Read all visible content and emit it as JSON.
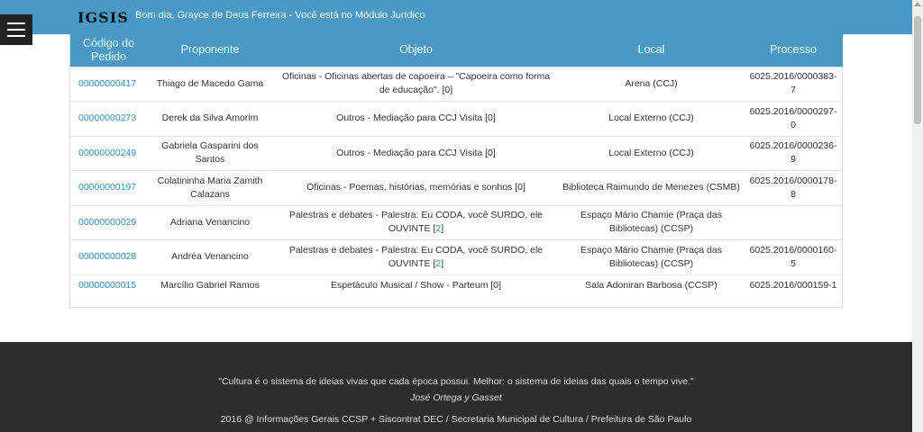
{
  "header": {
    "logo": "IGSIS",
    "greeting": "Bom dia, Grayce de Deus Ferreira - Você está no Módulo Jurídico"
  },
  "table": {
    "columns": [
      "Código do Pedido",
      "Proponente",
      "Objeto",
      "Local",
      "Processo"
    ],
    "rows": [
      {
        "code": "00000000417",
        "proponent": "Thiago de Macedo Gama",
        "object": "Oficinas - Oficinas abertas de capoeira – \"Capoeira como forma de educação\". [0]",
        "local": "Arena (CCJ)",
        "process": "6025.2016/0000383-7"
      },
      {
        "code": "00000000273",
        "proponent": "Derek da Silva Amorim",
        "object": "Outros - Mediação para CCJ Visita [0]",
        "local": "Local Externo (CCJ)",
        "process": "6025.2016/0000297-0"
      },
      {
        "code": "00000000249",
        "proponent": "Gabriela Gasparini dos Santos",
        "object": "Outros - Mediação para CCJ Visita [0]",
        "local": "Local Externo (CCJ)",
        "process": "6025.2016/0000236-9"
      },
      {
        "code": "00000000197",
        "proponent": "Colatininha Maria Zamith Calazans",
        "object": "Oficinas - Poemas, histórias, memórias e sonhos [0]",
        "local": "Biblioteca Raimundo de Menezes (CSMB)",
        "process": "6025.2016/0000178-8"
      },
      {
        "code": "00000000029",
        "proponent": "Adriana Venancino",
        "object_text": "Palestras e debates - Palestra: Eu CODA, você SURDO, ele OUVINTE [",
        "object_link": "2",
        "object_end": "]",
        "local": "Espaço Mário Chamie (Praça das Bibliotecas) (CCSP)",
        "process": ""
      },
      {
        "code": "00000000028",
        "proponent": "Andréa Venancino",
        "object_text": "Palestras e debates - Palestra: Eu CODA, você SURDO, ele OUVINTE [",
        "object_link": "2",
        "object_end": "]",
        "local": "Espaço Mário Chamie (Praça das Bibliotecas) (CCSP)",
        "process": "6025.2016/0000160-5"
      },
      {
        "code": "00000000015",
        "proponent": "Marcílio Gabriel Ramos",
        "object": "Espetáculo Musical / Show - Parteum [0]",
        "local": "Sala Adoniran Barbosa (CCSP)",
        "process": "6025.2016/000159-1"
      }
    ]
  },
  "footer": {
    "quote": "\"Cultura é o sistema de ideias vivas que cada época possui. Melhor: o sistema de ideias das quais o tempo vive.\"",
    "author": "José Ortega y Gasset",
    "credits": "2016 @ Informações Gerais CCSP + Siscontrat DEC / Secretaria Municipal de Cultura / Prefeitura de São Paulo"
  },
  "colors": {
    "accent": "#4a98c4",
    "link": "#3c8fc4",
    "footer_bg": "#2d2d2d"
  },
  "icons": {
    "menu": "hamburger-icon"
  }
}
